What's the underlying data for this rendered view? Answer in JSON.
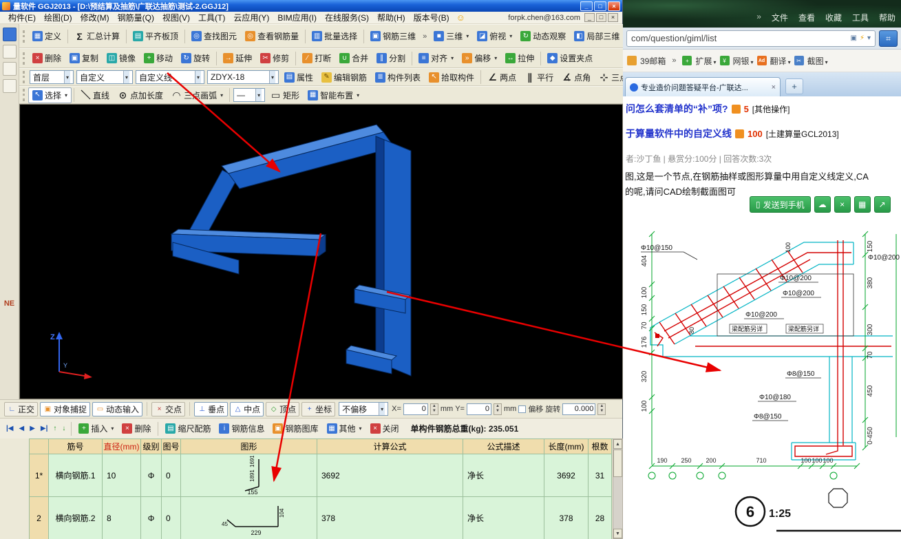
{
  "app": {
    "title": "量软件 GGJ2013 - [D:\\预结算及抽筋\\广联达抽筋\\测试-2.GGJ12]",
    "email": "forpk.chen@163.com",
    "menu": [
      "构件(E)",
      "绘图(D)",
      "修改(M)",
      "钢筋量(Q)",
      "视图(V)",
      "工具(T)",
      "云应用(Y)",
      "BIM应用(I)",
      "在线服务(S)",
      "帮助(H)",
      "版本号(B)"
    ],
    "toolbar_main": [
      "定义",
      "汇总计算",
      "平齐板顶",
      "查找图元",
      "查看钢筋量",
      "批量选择",
      "钢筋三维"
    ],
    "toolbar_view": [
      "三维",
      "俯视",
      "动态观察",
      "局部三维"
    ],
    "toolbar_edit": [
      "删除",
      "复制",
      "镜像",
      "移动",
      "旋转",
      "延伸",
      "修剪",
      "打断",
      "合并",
      "分割",
      "对齐",
      "偏移",
      "拉伸",
      "设置夹点"
    ],
    "combo_floor": "首层",
    "combo_category": "自定义",
    "combo_type": "自定义线",
    "combo_element": "ZDYX-18",
    "toolbar_element": [
      "属性",
      "编辑钢筋",
      "构件列表",
      "拾取构件"
    ],
    "toolbar_axis": [
      "两点",
      "平行",
      "点角",
      "三点辅轴"
    ],
    "select_label": "选择",
    "toolbar_draw": [
      "直线",
      "点加长度",
      "三点画弧",
      "矩形",
      "智能布置"
    ],
    "sidebar_label": "NE",
    "viewport_axes": {
      "z": "Z",
      "y": "Y"
    },
    "statusbar": {
      "toggles": [
        "正交",
        "对象捕捉",
        "动态输入"
      ],
      "snaps": [
        "交点",
        "垂点",
        "中点",
        "顶点",
        "坐标"
      ],
      "offset_mode": "不偏移",
      "x_label": "X=",
      "y_label": "Y=",
      "x_value": "0",
      "y_value": "0",
      "unit": "mm",
      "offset_label": "偏移",
      "rotate_label": "旋转",
      "rotate_value": "0.000"
    },
    "gridbar": {
      "insert": "插入",
      "delete": "删除",
      "scale_rebar": "缩尺配筋",
      "rebar_info": "钢筋信息",
      "rebar_lib": "钢筋图库",
      "other": "其他",
      "close": "关闭",
      "total": "单构件钢筋总重(kg): 235.051"
    },
    "table": {
      "headers": [
        "筋号",
        "直径(mm)",
        "级别",
        "图号",
        "图形",
        "计算公式",
        "公式描述",
        "长度(mm)",
        "根数"
      ],
      "rows": [
        {
          "num": "1*",
          "name": "横向钢筋.1",
          "dia": "10",
          "level": "Φ",
          "pic": "0",
          "seg_a": "1691",
          "seg_b": "1891",
          "seg_c": "155",
          "formula": "3692",
          "desc": "净长",
          "length": "3692",
          "count": "31"
        },
        {
          "num": "2",
          "name": "横向钢筋.2",
          "dia": "8",
          "level": "Φ",
          "pic": "0",
          "seg_a": "104",
          "seg_b": "229",
          "seg_c": "45",
          "formula": "378",
          "desc": "净长",
          "length": "378",
          "count": "28"
        }
      ]
    }
  },
  "browser": {
    "menu": [
      "文件",
      "查看",
      "收藏",
      "工具",
      "帮助"
    ],
    "url": "com/question/giml/list",
    "bookmarks": [
      "39邮箱",
      "扩展",
      "网银",
      "翻译",
      "截图"
    ],
    "tab_title": "专业造价问题答疑平台-广联达...",
    "q1": {
      "link": "问怎么套清单的“补”项?",
      "score": "5",
      "tag": "[其他操作]"
    },
    "q2": {
      "link": "于算量软件中的自定义线",
      "score": "100",
      "tag": "[土建算量GCL2013]"
    },
    "meta": "者:沙丁鱼  |  悬赏分:100分  |  回答次数:3次",
    "body1": "图,这是一个节点,在钢筋抽样或图形算量中用自定义线定义,CA",
    "body2": "的呢,请问CAD绘制截面图可",
    "send_button": "发送到手机",
    "cad": {
      "left_dims": [
        "404",
        "100",
        "150",
        "70",
        "176",
        "320",
        "100"
      ],
      "right_dims": [
        "150",
        "380",
        "300",
        "70",
        "450",
        "0-450"
      ],
      "bottom_dims": [
        "190",
        "250",
        "200",
        "710",
        "100",
        "100",
        "100"
      ],
      "labels": [
        "Φ10@150",
        "Φ10@200",
        "Φ10@200",
        "Φ10@200",
        "Φ10@200",
        "梁配筋另详",
        "梁配筋另详",
        "Φ8@150",
        "Φ10@180",
        "Φ8@150"
      ],
      "rot_labels": [
        "80",
        "100"
      ],
      "bubble": "6",
      "scale": "1:25"
    }
  }
}
